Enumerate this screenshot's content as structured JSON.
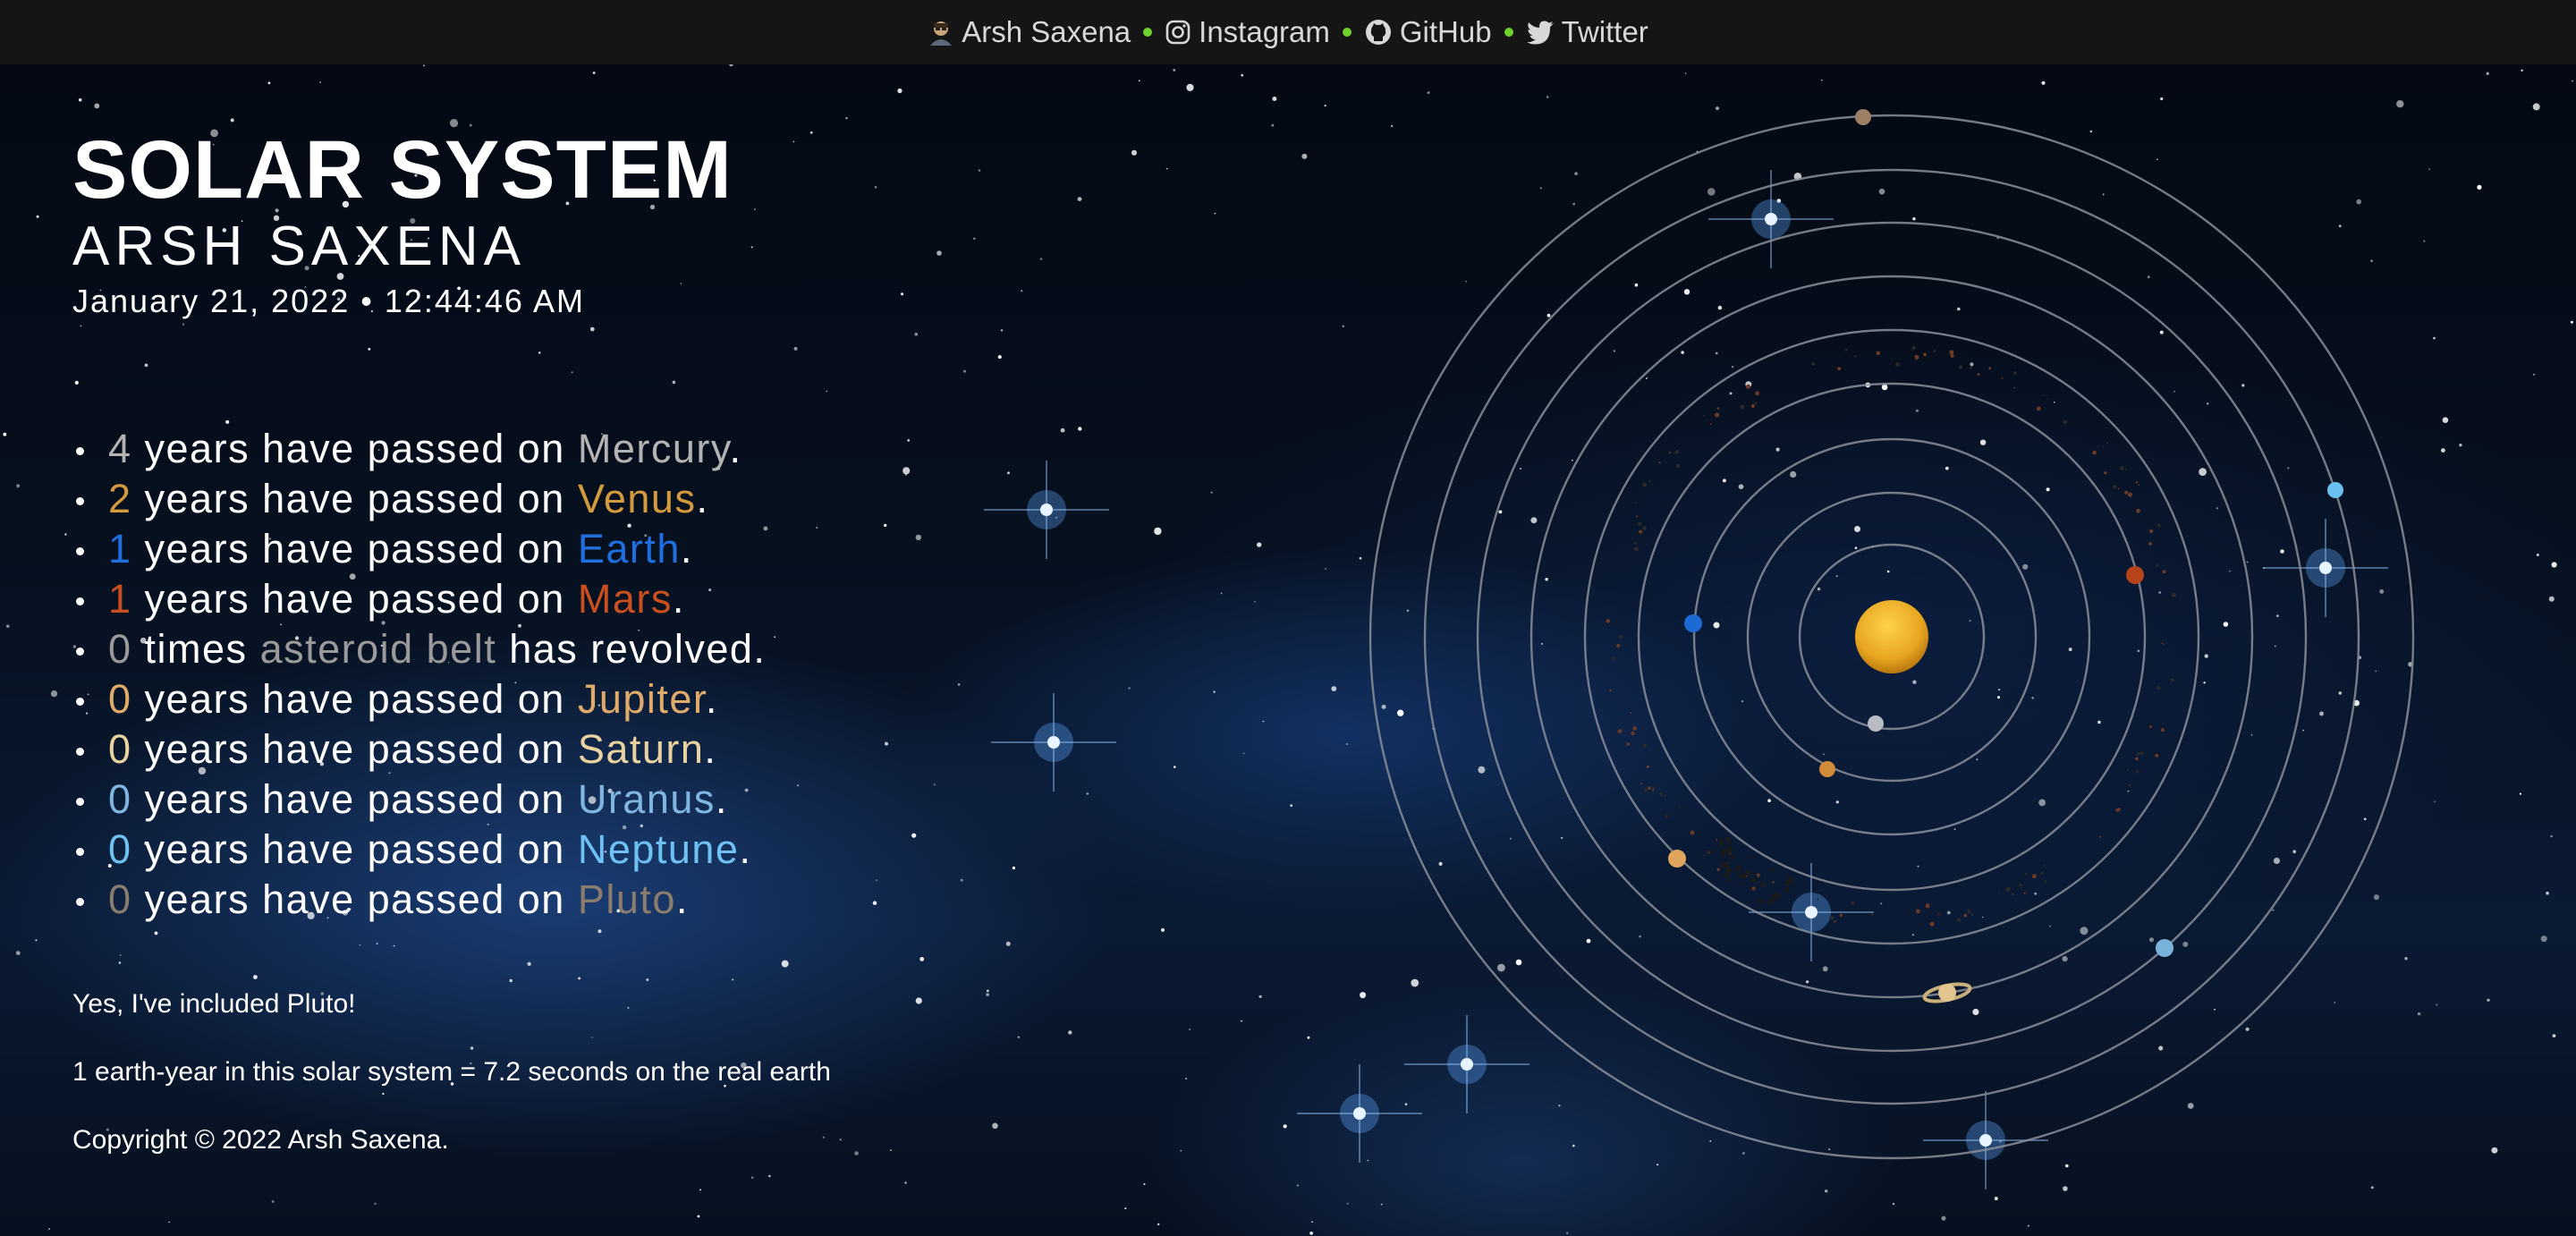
{
  "topbar": {
    "author": "Arsh Saxena",
    "instagram": "Instagram",
    "github": "GitHub",
    "twitter": "Twitter",
    "dot_color": "#6fd22c"
  },
  "header": {
    "title": "SOLAR SYSTEM",
    "subtitle": "ARSH SAXENA",
    "datetime": "January 21, 2022 • 12:44:46 AM"
  },
  "planets": [
    {
      "count": "4",
      "pre": " years have passed on ",
      "name": "Mercury",
      "post": ".",
      "color": "#b3b3b3"
    },
    {
      "count": "2",
      "pre": " years have passed on ",
      "name": "Venus",
      "post": ".",
      "color": "#d49a3e"
    },
    {
      "count": "1",
      "pre": " years have passed on ",
      "name": "Earth",
      "post": ".",
      "color": "#1f6fe0"
    },
    {
      "count": "1",
      "pre": " years have passed on ",
      "name": "Mars",
      "post": ".",
      "color": "#c9501e"
    },
    {
      "count": "0",
      "pre": " times ",
      "name": "asteroid belt",
      "post": " has revolved.",
      "color": "#9a9a9a"
    },
    {
      "count": "0",
      "pre": " years have passed on ",
      "name": "Jupiter",
      "post": ".",
      "color": "#e0ab6a"
    },
    {
      "count": "0",
      "pre": " years have passed on ",
      "name": "Saturn",
      "post": ".",
      "color": "#e8d3a0"
    },
    {
      "count": "0",
      "pre": " years have passed on ",
      "name": "Uranus",
      "post": ".",
      "color": "#7fb6e0"
    },
    {
      "count": "0",
      "pre": " years have passed on ",
      "name": "Neptune",
      "post": ".",
      "color": "#6ec1f2"
    },
    {
      "count": "0",
      "pre": " years have passed on ",
      "name": "Pluto",
      "post": ".",
      "color": "#8a7d6e"
    }
  ],
  "notes": {
    "pluto": "Yes, I've included Pluto!",
    "scale": "1 earth-year in this solar system = 7.2 seconds on the real earth",
    "copyright": "Copyright © 2022 Arsh Saxena."
  },
  "colors": {
    "sun": "#e8a520",
    "orbit": "#8a8f9a",
    "mercury": "#b9bcc2",
    "venus": "#d38c3c",
    "earth": "#1c6ad6",
    "mars": "#b8441a",
    "jupiter": "#e0a55c",
    "saturn": "#e3c68f",
    "uranus": "#7ab3d9",
    "neptune": "#6ac0f0",
    "pluto": "#9b8066"
  }
}
